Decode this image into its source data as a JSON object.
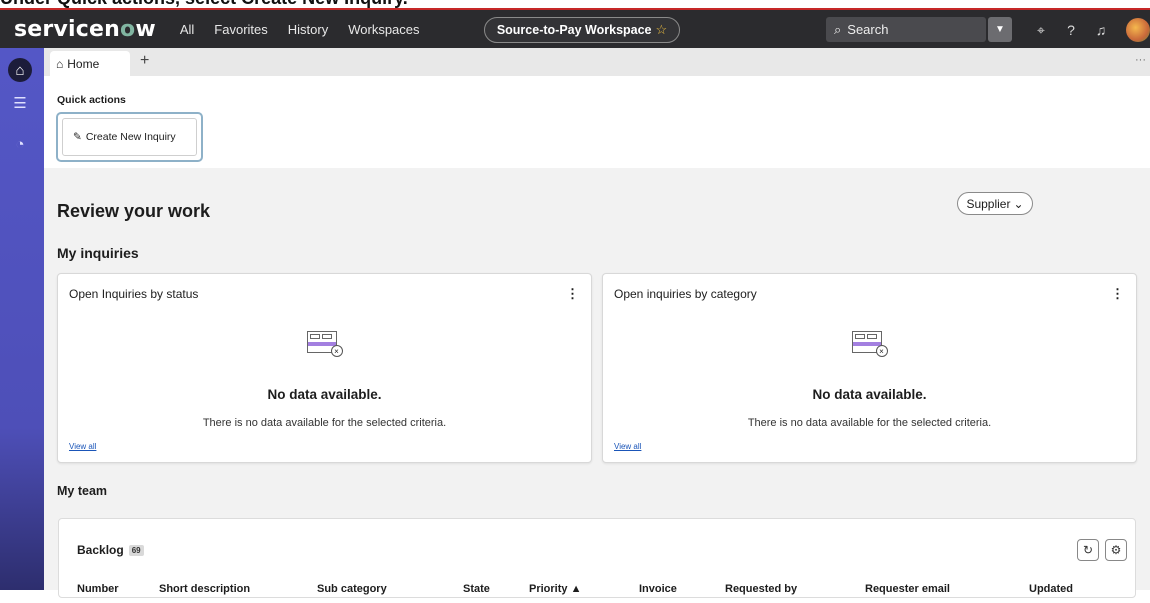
{
  "caption": "Under Quick actions, select Create New Inquiry.",
  "topbar": {
    "logo_prefix": "servicen",
    "logo_o": "o",
    "logo_suffix": "w",
    "nav": [
      "All",
      "Favorites",
      "History",
      "Workspaces"
    ],
    "workspace": "Source-to-Pay Workspace",
    "search_placeholder": "Search",
    "icons": [
      "search-icon",
      "chat-icon",
      "help-icon",
      "bell-icon",
      "avatar"
    ]
  },
  "tabs": {
    "home": "Home",
    "add": "+",
    "more": "···"
  },
  "quick_actions": {
    "title": "Quick actions",
    "button": "Create New Inquiry"
  },
  "review": {
    "title": "Review your work",
    "filter": "Supplier",
    "section": "My inquiries"
  },
  "cards": [
    {
      "title": "Open Inquiries by status",
      "empty_title": "No data available.",
      "empty_sub": "There is no data available for the selected criteria.",
      "link": "View all"
    },
    {
      "title": "Open inquiries by category",
      "empty_title": "No data available.",
      "empty_sub": "There is no data available for the selected criteria.",
      "link": "View all"
    }
  ],
  "team": {
    "title": "My team",
    "backlog_label": "Backlog",
    "backlog_count": "69",
    "columns": [
      "Number",
      "Short description",
      "Sub category",
      "State",
      "Priority ▲",
      "Invoice",
      "Requested by",
      "Requester email",
      "Updated"
    ]
  }
}
